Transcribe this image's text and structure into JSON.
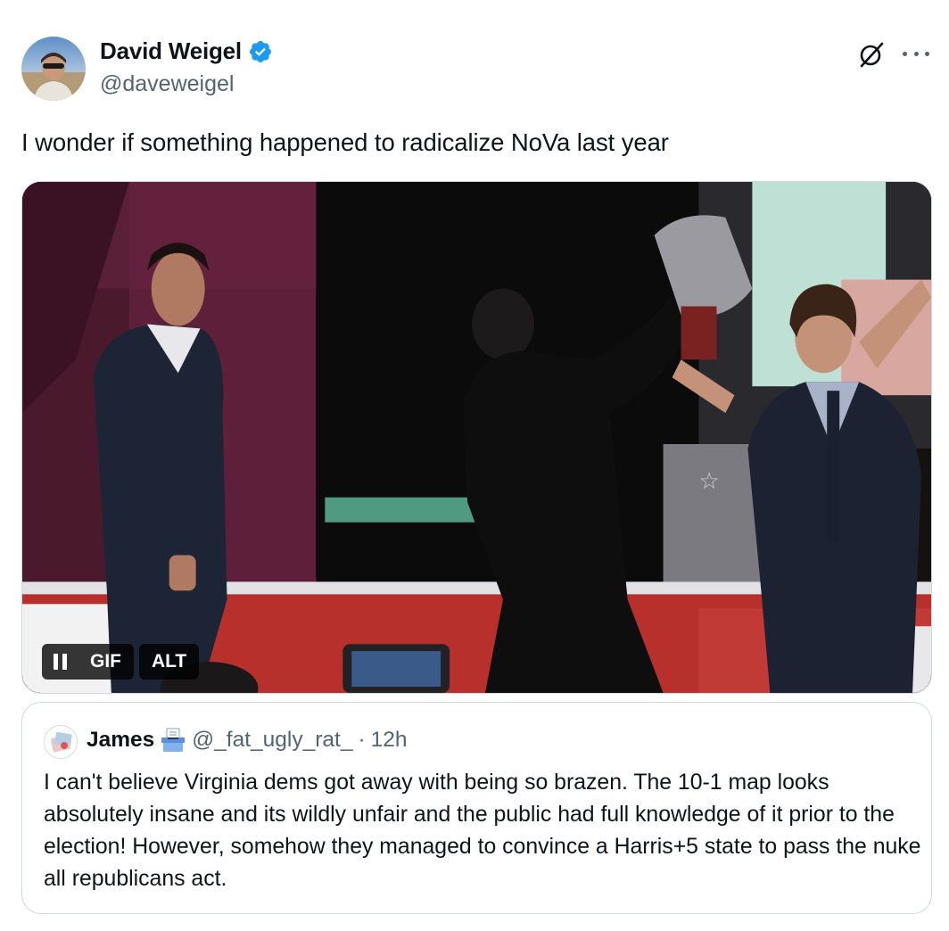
{
  "author": {
    "display_name": "David Weigel",
    "handle": "@daveweigel",
    "verified": true,
    "verified_color": "#1d9bf0"
  },
  "tweet": {
    "text": "I wonder if something happened to radicalize NoVa last year"
  },
  "media": {
    "type": "GIF",
    "controls": {
      "pause_icon": "pause-icon",
      "gif_label": "GIF",
      "alt_label": "ALT"
    }
  },
  "quoted_tweet": {
    "display_name": "James",
    "emoji_icon": "ballot-box-icon",
    "handle": "@_fat_ugly_rat_",
    "separator": "·",
    "time": "12h",
    "text": "I can't believe Virginia dems got away with being so brazen. The 10-1 map looks absolutely insane and its wildly unfair and the public had full knowledge of it prior to the election! However, somehow they managed to convince a Harris+5 state to pass the nuke all republicans act."
  },
  "icons": {
    "grok": "grok-icon",
    "more": "more-horizontal-icon"
  },
  "colors": {
    "text_primary": "#0f1419",
    "text_secondary": "#536471",
    "border": "#cfd9de"
  }
}
